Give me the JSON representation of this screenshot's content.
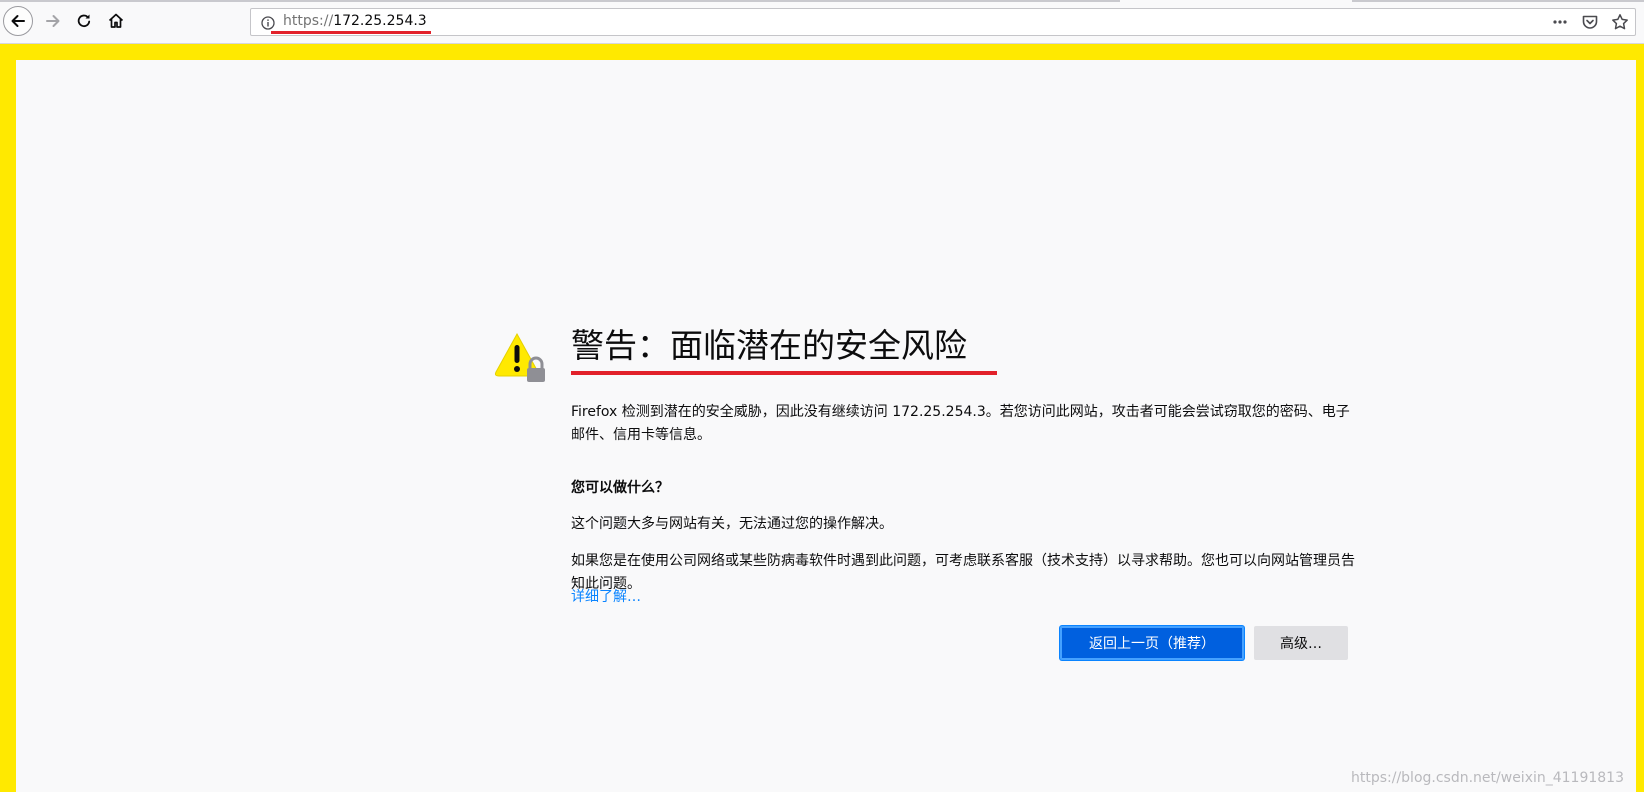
{
  "toolbar": {
    "back_tooltip": "Back",
    "forward_tooltip": "Forward",
    "reload_tooltip": "Reload",
    "home_tooltip": "Home"
  },
  "urlbar": {
    "scheme": "https://",
    "host": "172.25.254.3"
  },
  "error_page": {
    "title": "警告：面临潜在的安全风险",
    "intro": "Firefox 检测到潜在的安全威胁，因此没有继续访问 172.25.254.3。若您访问此网站，攻击者可能会尝试窃取您的密码、电子邮件、信用卡等信息。",
    "question": "您可以做什么？",
    "answer_1": "这个问题大多与网站有关，无法通过您的操作解决。",
    "answer_2": "如果您是在使用公司网络或某些防病毒软件时遇到此问题，可考虑联系客服（技术支持）以寻求帮助。您也可以向网站管理员告知此问题。",
    "learn_more": "详细了解…",
    "go_back_button": "返回上一页（推荐）",
    "advanced_button": "高级…"
  },
  "watermark": "https://blog.csdn.net/weixin_41191813",
  "colors": {
    "page_background": "#f9f9fa",
    "frame": "#ffe900",
    "primary_button": "#0060df",
    "link": "#0a84ff",
    "annotation_red": "#e2212a",
    "warning_yellow": "#ffe900"
  },
  "icons": {
    "back": "arrow-left-icon",
    "forward": "arrow-right-icon",
    "reload": "reload-icon",
    "home": "home-icon",
    "info": "info-icon",
    "page_actions": "more-horizontal-icon",
    "pocket": "pocket-icon",
    "bookmark": "star-icon",
    "warning": "warning-lock-icon"
  }
}
